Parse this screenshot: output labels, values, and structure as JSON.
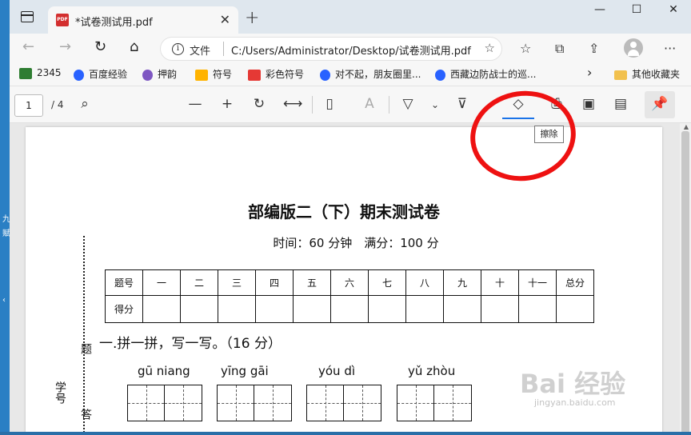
{
  "browser": {
    "tab_title": "*试卷测试用.pdf",
    "tab_icon_text": "PDF",
    "new_tab": "+",
    "address_label": "文件",
    "url": "C:/Users/Administrator/Desktop/试卷测试用.pdf"
  },
  "favorites": [
    {
      "label": "2345",
      "icon_color": "#2e7d32"
    },
    {
      "label": "百度经验",
      "icon_color": "#2962ff"
    },
    {
      "label": "押韵",
      "icon_color": "#7e57c2"
    },
    {
      "label": "符号",
      "icon_color": "#ffb300"
    },
    {
      "label": "彩色符号",
      "icon_color": "#e53935"
    },
    {
      "label": "对不起，朋友圈里...",
      "icon_color": "#2962ff"
    },
    {
      "label": "西藏边防战士的巡...",
      "icon_color": "#2962ff"
    }
  ],
  "favorites_more": "其他收藏夹",
  "pdf_toolbar": {
    "page_current": "1",
    "page_total": "/ 4",
    "tooltip": "擦除"
  },
  "document": {
    "title": "部编版二（下）期末测试卷",
    "subtitle": "时间：60 分钟　满分：100 分",
    "score_header": [
      "题号",
      "一",
      "二",
      "三",
      "四",
      "五",
      "六",
      "七",
      "八",
      "九",
      "十",
      "十一",
      "总分"
    ],
    "score_row_label": "得分",
    "section1": "一.拼一拼，写一写。（16 分）",
    "pinyin": [
      "gū  niang",
      "yīng gāi",
      "yóu   dì",
      "yǔ zhòu"
    ],
    "side_labels": [
      "学号",
      "题",
      "答"
    ]
  },
  "watermark": {
    "main": "Bai 经验",
    "sub": "jingyan.baidu.com"
  },
  "colors": {
    "accent": "#1a73e8",
    "annotation": "#ee1111"
  }
}
